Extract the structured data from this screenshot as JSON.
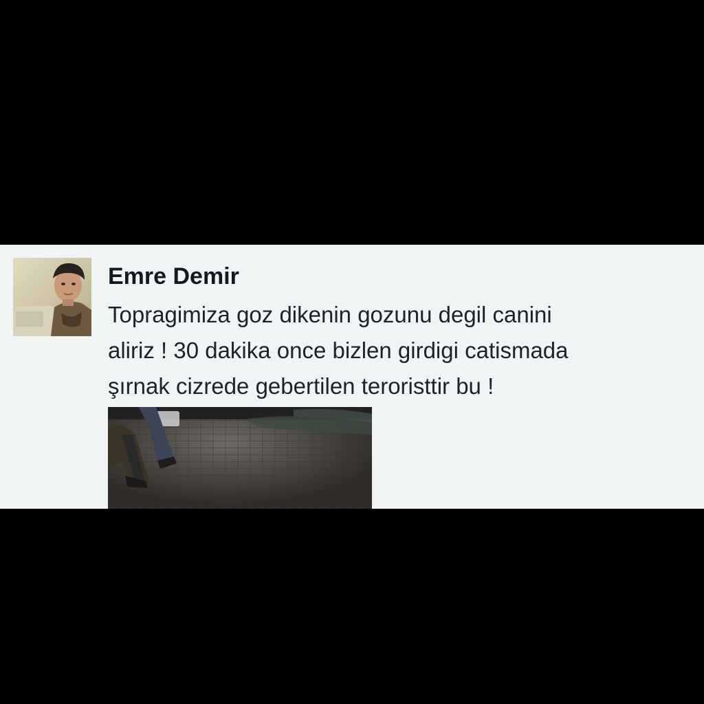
{
  "post": {
    "author": "Emre Demir",
    "text_lines": [
      "Topragimiza goz dikenin gozunu degil canini",
      "aliriz ! 30 dakika once bizlen girdigi catismada",
      "şırnak cizrede gebertilen teroristtir bu !"
    ],
    "avatar_icon": "profile-photo",
    "image_icon": "night-street-photo"
  },
  "colors": {
    "background": "#000000",
    "card": "#f1f4f4",
    "author_text": "#141823",
    "body_text": "#1d2129"
  }
}
